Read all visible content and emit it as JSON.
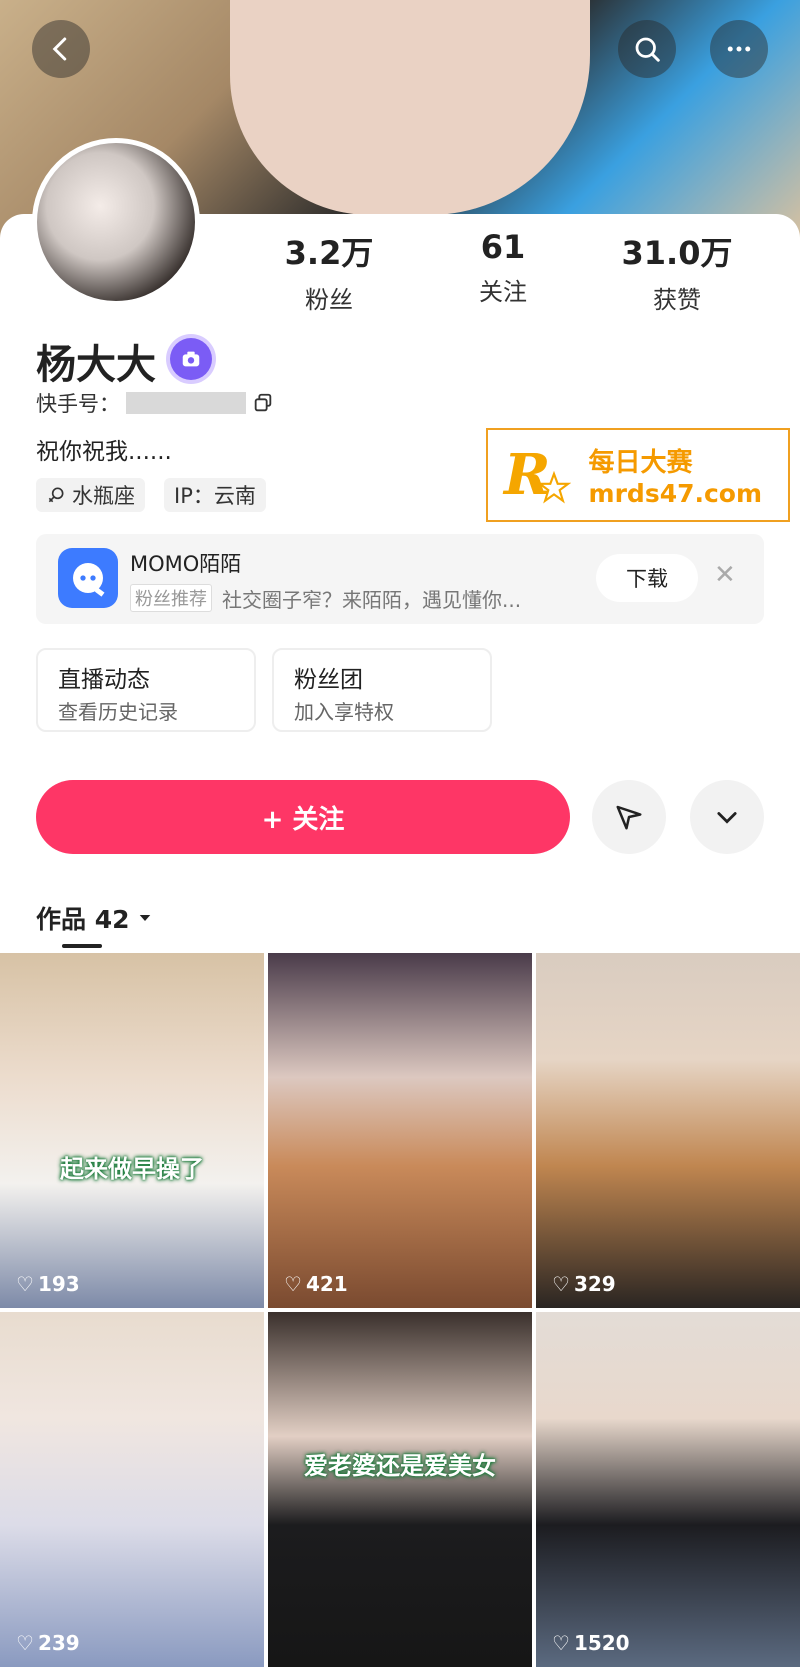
{
  "profile": {
    "name": "杨大大",
    "kuaishou_label": "快手号：",
    "bio": "祝你祝我......",
    "tags": [
      "水瓶座",
      "IP：云南"
    ]
  },
  "stats": [
    {
      "value": "3.2万",
      "label": "粉丝"
    },
    {
      "value": "61",
      "label": "关注"
    },
    {
      "value": "31.0万",
      "label": "获赞"
    }
  ],
  "watermark": {
    "line1": "每日大赛",
    "line2": "mrds47.com",
    "logo_letter": "R"
  },
  "ad": {
    "title": "MOMO陌陌",
    "recommend": "粉丝推荐",
    "desc": "社交圈子窄？来陌陌，遇见懂你...",
    "button": "下载"
  },
  "cards": [
    {
      "title": "直播动态",
      "sub": "查看历史记录"
    },
    {
      "title": "粉丝团",
      "sub": "加入享特权"
    }
  ],
  "actions": {
    "follow": "+ 关注"
  },
  "works": {
    "label": "作品 42"
  },
  "videos": [
    {
      "likes": "193",
      "caption": "起来做早操了"
    },
    {
      "likes": "421",
      "caption": ""
    },
    {
      "likes": "329",
      "caption": ""
    },
    {
      "likes": "239",
      "caption": ""
    },
    {
      "likes": "",
      "caption": "爱老婆还是爱美女"
    },
    {
      "likes": "1520",
      "caption": ""
    }
  ],
  "colors": {
    "accent": "#fe3666",
    "badge": "#7b5cf5",
    "watermark": "#f5a600"
  }
}
